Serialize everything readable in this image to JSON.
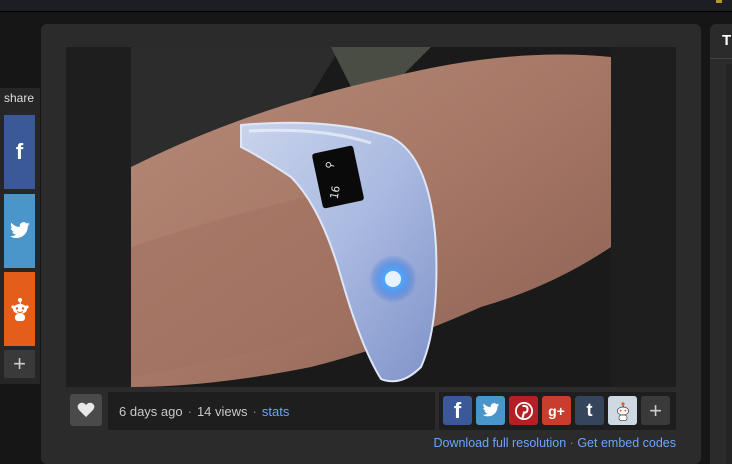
{
  "share": {
    "label": "share",
    "buttons": [
      {
        "name": "facebook",
        "icon": "facebook-icon",
        "glyph": "f",
        "color": "#3b5998"
      },
      {
        "name": "twitter",
        "icon": "twitter-icon",
        "color": "#4a95c9"
      },
      {
        "name": "reddit",
        "icon": "reddit-icon",
        "color": "#e45d1b"
      }
    ],
    "more_glyph": "+"
  },
  "image": {
    "description_icon": "fitness-wristband-photo"
  },
  "meta": {
    "posted": "6 days ago",
    "separator": "·",
    "views": "14 views",
    "stats_link": "stats"
  },
  "social_bar": {
    "facebook_glyph": "f",
    "gplus_glyph": "g+",
    "tumblr_glyph": "t",
    "more_glyph": "+"
  },
  "links": {
    "download": "Download full resolution",
    "separator": "·",
    "embed": "Get embed codes"
  },
  "right_panel": {
    "title_letter": "T"
  },
  "colors": {
    "background": "#161616",
    "panel": "#2b2b2b",
    "link": "#6aa6ff",
    "accent_top": "#b59a2b"
  }
}
